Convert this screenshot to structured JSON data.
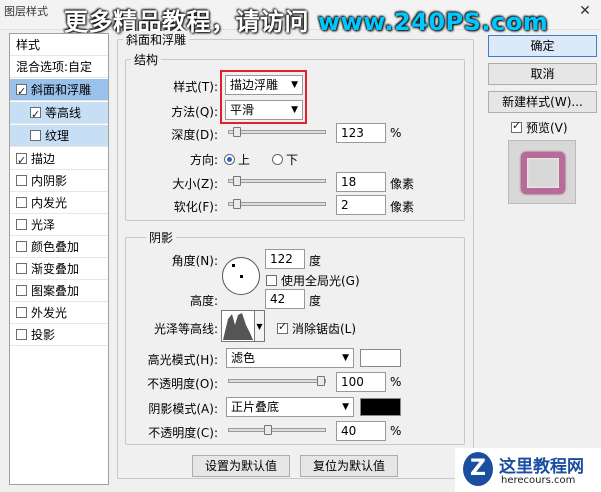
{
  "window": {
    "title": "图层样式",
    "close_label": "✕"
  },
  "watermark": {
    "text": "更多精品教程，请访问 ",
    "url": "www.240PS.com"
  },
  "sidebar": {
    "items": [
      {
        "label": "样式",
        "checkbox": false
      },
      {
        "label": "混合选项:自定",
        "checkbox": false
      },
      {
        "label": "斜面和浮雕",
        "checkbox": true,
        "checked": true,
        "state": "selected"
      },
      {
        "label": "等高线",
        "checkbox": true,
        "checked": true,
        "state": "subsel"
      },
      {
        "label": "纹理",
        "checkbox": true,
        "checked": false,
        "state": "subsel"
      },
      {
        "label": "描边",
        "checkbox": true,
        "checked": true
      },
      {
        "label": "内阴影",
        "checkbox": true,
        "checked": false
      },
      {
        "label": "内发光",
        "checkbox": true,
        "checked": false
      },
      {
        "label": "光泽",
        "checkbox": true,
        "checked": false
      },
      {
        "label": "颜色叠加",
        "checkbox": true,
        "checked": false
      },
      {
        "label": "渐变叠加",
        "checkbox": true,
        "checked": false
      },
      {
        "label": "图案叠加",
        "checkbox": true,
        "checked": false
      },
      {
        "label": "外发光",
        "checkbox": true,
        "checked": false
      },
      {
        "label": "投影",
        "checkbox": true,
        "checked": false
      }
    ]
  },
  "bevel": {
    "title": "斜面和浮雕",
    "structure": {
      "title": "结构",
      "style_label": "样式(T):",
      "style_value": "描边浮雕",
      "technique_label": "方法(Q):",
      "technique_value": "平滑",
      "depth_label": "深度(D):",
      "depth_value": "123",
      "depth_unit": "%",
      "direction_label": "方向:",
      "direction_up": "上",
      "direction_down": "下",
      "size_label": "大小(Z):",
      "size_value": "18",
      "size_unit": "像素",
      "soften_label": "软化(F):",
      "soften_value": "2",
      "soften_unit": "像素"
    },
    "shading": {
      "title": "阴影",
      "angle_label": "角度(N):",
      "angle_value": "122",
      "angle_unit": "度",
      "global_light_label": "使用全局光(G)",
      "altitude_label": "高度:",
      "altitude_value": "42",
      "altitude_unit": "度",
      "gloss_label": "光泽等高线:",
      "antialias_label": "消除锯齿(L)",
      "highlight_mode_label": "高光模式(H):",
      "highlight_mode_value": "滤色",
      "highlight_color": "#ffffff",
      "highlight_opacity_label": "不透明度(O):",
      "highlight_opacity_value": "100",
      "highlight_opacity_unit": "%",
      "shadow_mode_label": "阴影模式(A):",
      "shadow_mode_value": "正片叠底",
      "shadow_color": "#000000",
      "shadow_opacity_label": "不透明度(C):",
      "shadow_opacity_value": "40",
      "shadow_opacity_unit": "%"
    },
    "set_default": "设置为默认值",
    "reset_default": "复位为默认值"
  },
  "slider_levels": {
    "depth": 0.04,
    "size": 0.04,
    "soften": 0.04,
    "highlight_opacity": 1.0,
    "shadow_opacity": 0.4
  },
  "buttons": {
    "ok": "确定",
    "cancel": "取消",
    "new_style": "新建样式(W)...",
    "preview": "预览(V)"
  },
  "logo": {
    "mark": "Z",
    "name": "这里教程网",
    "domain": "herecours.com"
  },
  "colors": {
    "selection": "#9ac1ea",
    "highlight_red": "#e0202a",
    "preview_frame": "#b86a98"
  }
}
